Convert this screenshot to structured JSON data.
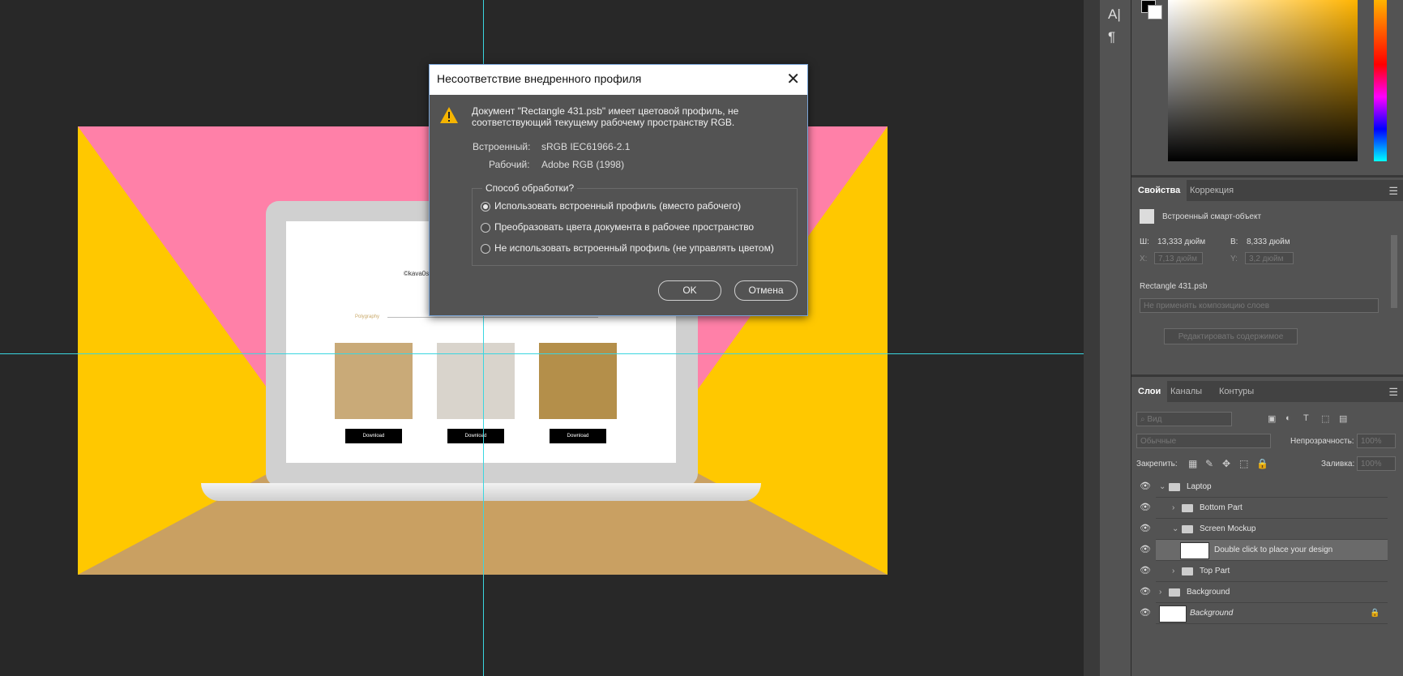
{
  "colors": {
    "pink": "#ff80a8",
    "yellow": "#ffc800",
    "tan": "#c9a062",
    "guide": "#3ad6e0",
    "panel": "#535353",
    "dialog_border": "#7aa5d8"
  },
  "canvas": {
    "site_title": "©kava0stt",
    "site_sub": "Polygraphy",
    "download_label": "Download"
  },
  "toolstrip": {
    "text_tool": "A|",
    "paragraph_tool": "¶"
  },
  "properties": {
    "tabs": [
      "Свойства",
      "Коррекция"
    ],
    "smart_object": "Встроенный смарт-объект",
    "w_label": "Ш:",
    "w_value": "13,333 дюйм",
    "h_label": "В:",
    "h_value": "8,333 дюйм",
    "x_label": "X:",
    "x_value": "7,13 дюйм",
    "y_label": "Y:",
    "y_value": "3,2 дюйм",
    "file": "Rectangle 431.psb",
    "comp_dropdown": "Не применять композицию слоев",
    "edit_button": "Редактировать содержимое"
  },
  "layers_panel": {
    "tabs": [
      "Слои",
      "Каналы",
      "Контуры"
    ],
    "search_placeholder": "Вид",
    "blend_mode": "Обычные",
    "opacity_label": "Непрозрачность:",
    "opacity_value": "100%",
    "lock_label": "Закрепить:",
    "fill_label": "Заливка:",
    "fill_value": "100%",
    "layers": [
      {
        "name": "Laptop",
        "type": "group"
      },
      {
        "name": "Bottom Part",
        "type": "group"
      },
      {
        "name": "Screen Mockup",
        "type": "group"
      },
      {
        "name": "Double click to place your design",
        "type": "smart"
      },
      {
        "name": "Top Part",
        "type": "group"
      },
      {
        "name": "Background",
        "type": "group"
      },
      {
        "name": "Background",
        "type": "pixel"
      }
    ]
  },
  "dialog": {
    "title": "Несоответствие внедренного профиля",
    "message": "Документ \"Rectangle 431.psb\" имеет цветовой профиль, не соответствующий текущему рабочему пространству RGB.",
    "embedded_label": "Встроенный:",
    "embedded_value": "sRGB IEC61966-2.1",
    "working_label": "Рабочий:",
    "working_value": "Adobe RGB (1998)",
    "group_title": "Способ обработки?",
    "options": [
      "Использовать встроенный профиль (вместо рабочего)",
      "Преобразовать цвета документа в рабочее пространство",
      "Не использовать встроенный профиль (не управлять цветом)"
    ],
    "selected_option": 0,
    "ok_label": "OK",
    "cancel_label": "Отмена"
  }
}
